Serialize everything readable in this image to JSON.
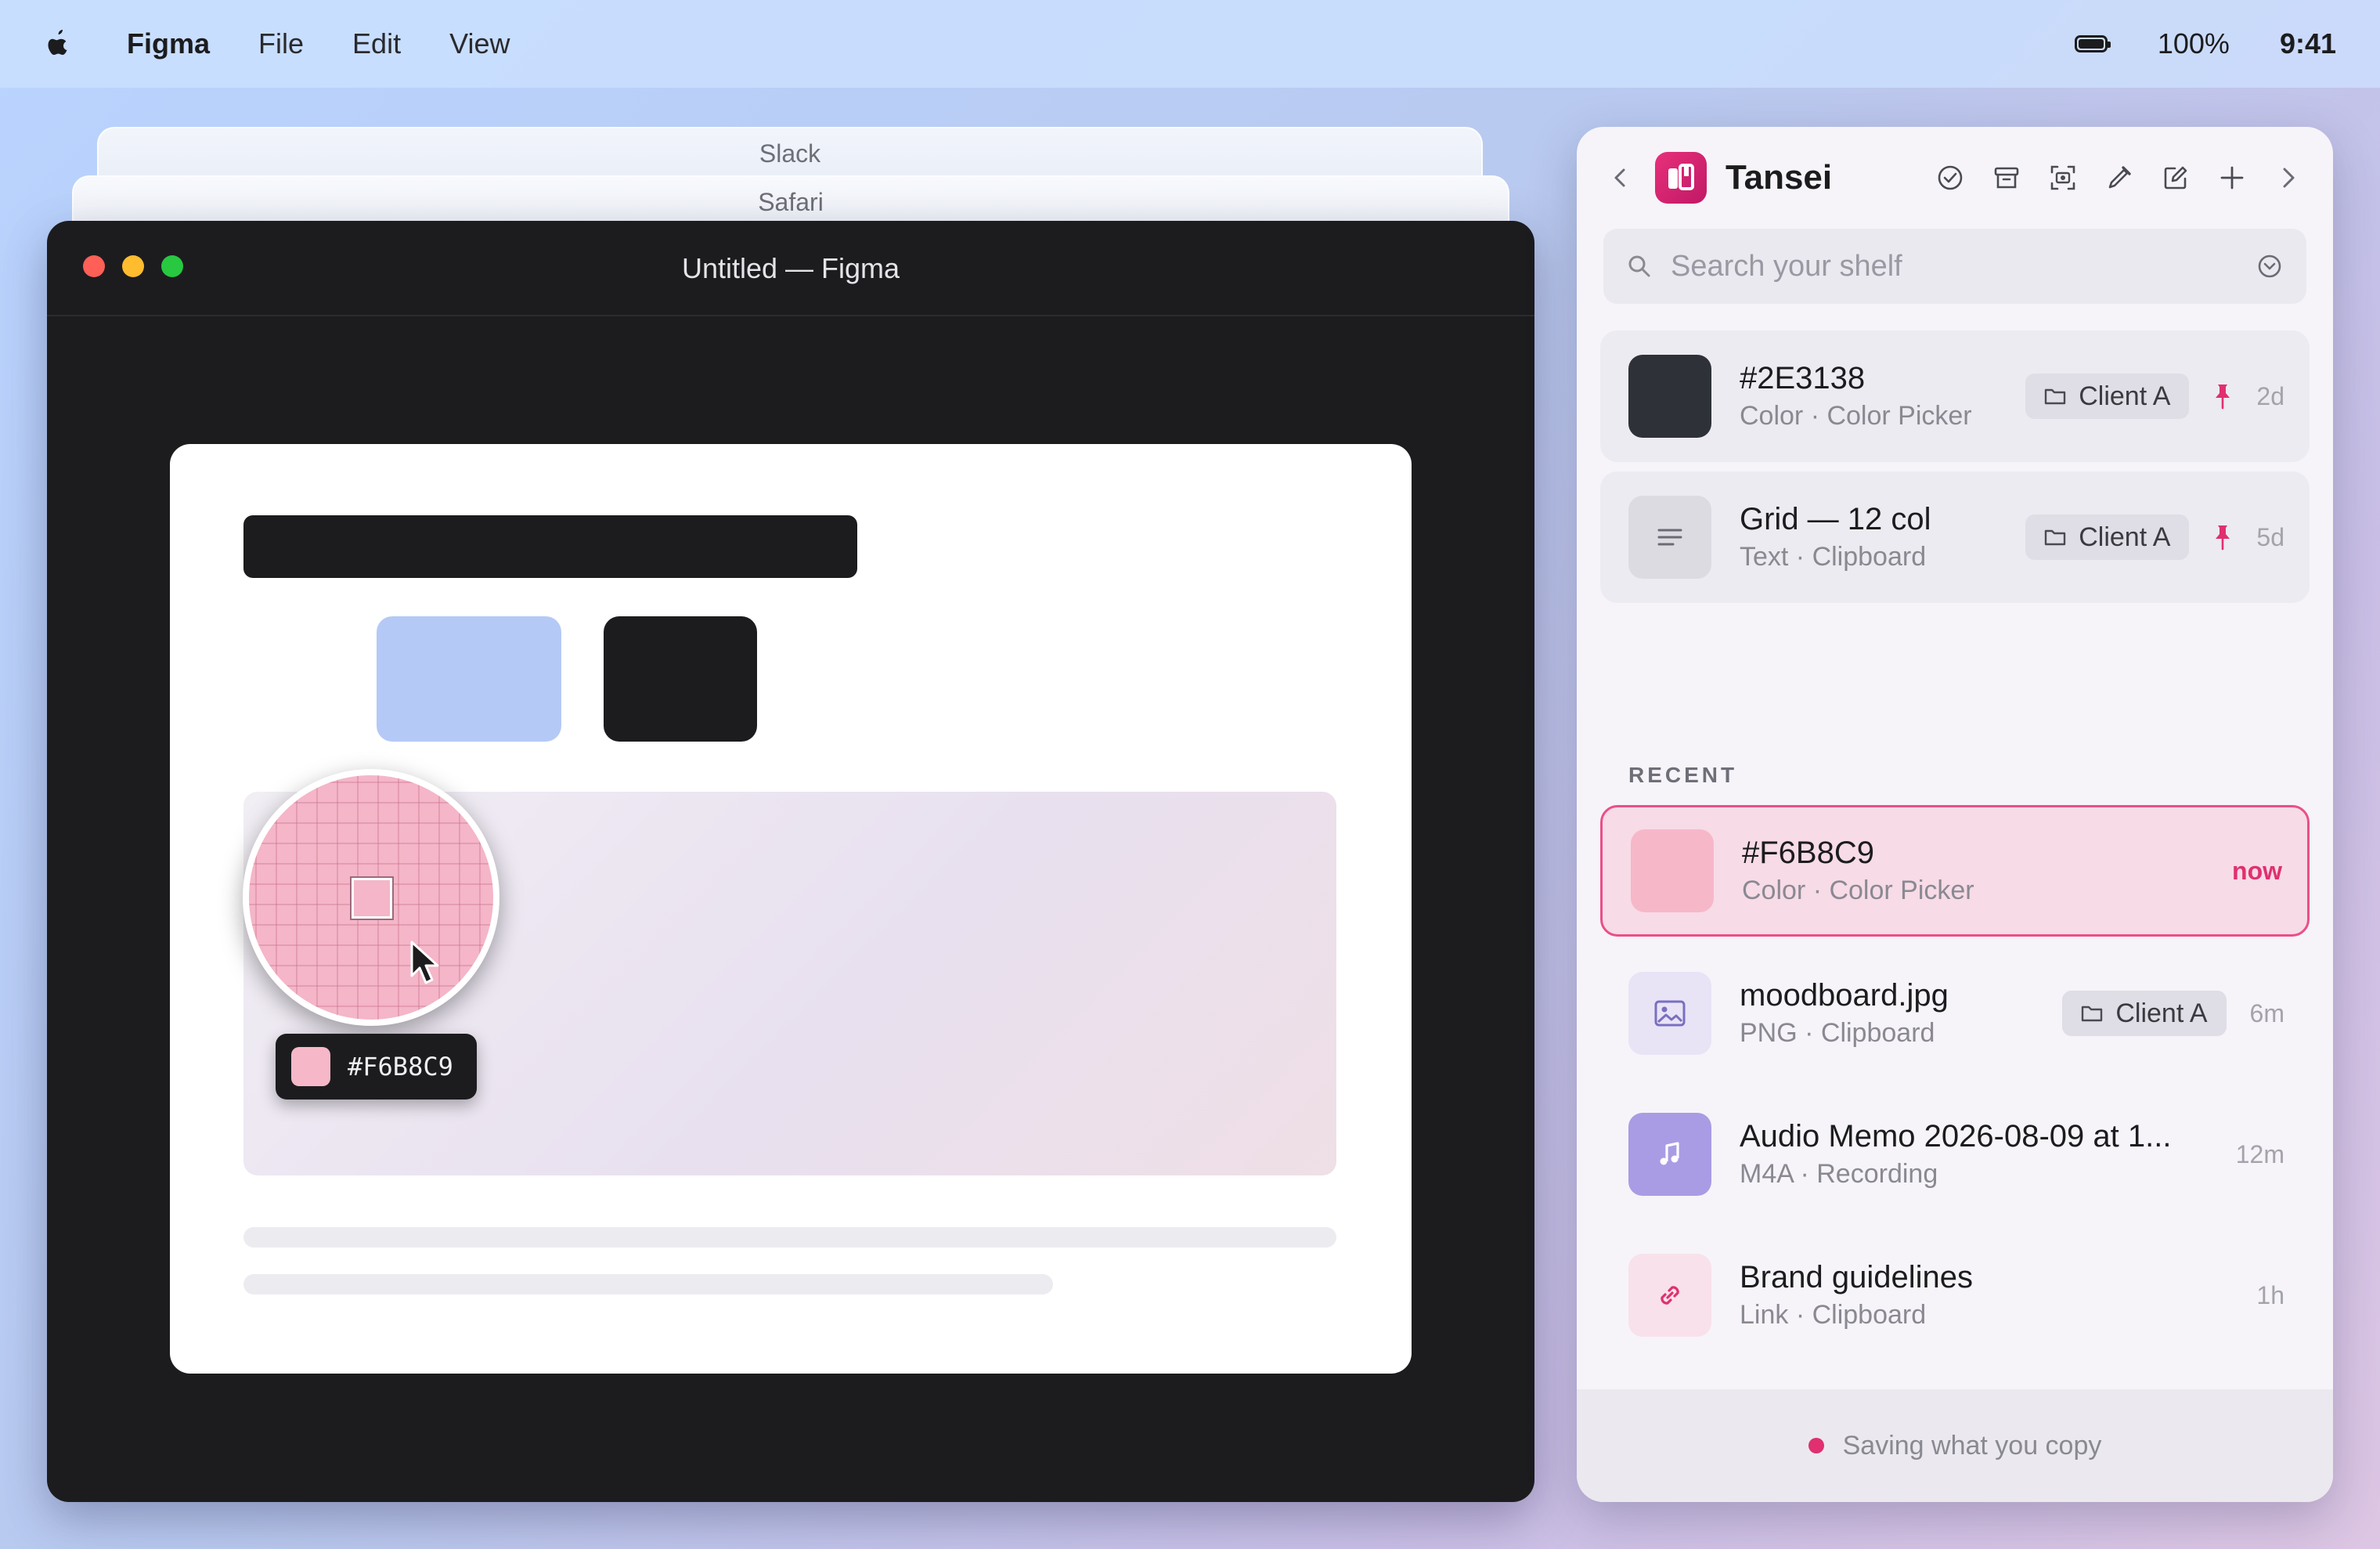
{
  "menubar": {
    "app": "Figma",
    "items": [
      "File",
      "Edit",
      "View"
    ],
    "battery": "100%",
    "time": "9:41"
  },
  "background_windows": {
    "slack": "Slack",
    "safari": "Safari"
  },
  "figma_window": {
    "title": "Untitled — Figma",
    "picker": {
      "hex": "#F6B8C9",
      "color": "#F6B8C9"
    }
  },
  "tansei": {
    "name": "Tansei",
    "search_placeholder": "Search your shelf",
    "section_recent": "RECENT",
    "pinned": [
      {
        "title": "#2E3138",
        "sub": "Color · Color Picker",
        "tag": "Client A",
        "time": "2d",
        "color": "#2E3138",
        "icon": "color-swatch"
      },
      {
        "title": "Grid — 12 col",
        "sub": "Text · Clipboard",
        "tag": "Client A",
        "time": "5d",
        "icon": "text-lines-icon"
      }
    ],
    "recent": [
      {
        "title": "#F6B8C9",
        "sub": "Color · Color Picker",
        "time": "now",
        "color": "#F6B8C9",
        "icon": "color-swatch"
      },
      {
        "title": "moodboard.jpg",
        "sub": "PNG · Clipboard",
        "tag": "Client A",
        "time": "6m",
        "icon": "image-icon"
      },
      {
        "title": "Audio Memo 2026-08-09 at 1...",
        "sub": "M4A · Recording",
        "time": "12m",
        "icon": "music-note-icon"
      },
      {
        "title": "Brand guidelines",
        "sub": "Link · Clipboard",
        "time": "1h",
        "icon": "link-icon"
      }
    ],
    "footer": "Saving what you copy",
    "accent": "#E0306F"
  }
}
